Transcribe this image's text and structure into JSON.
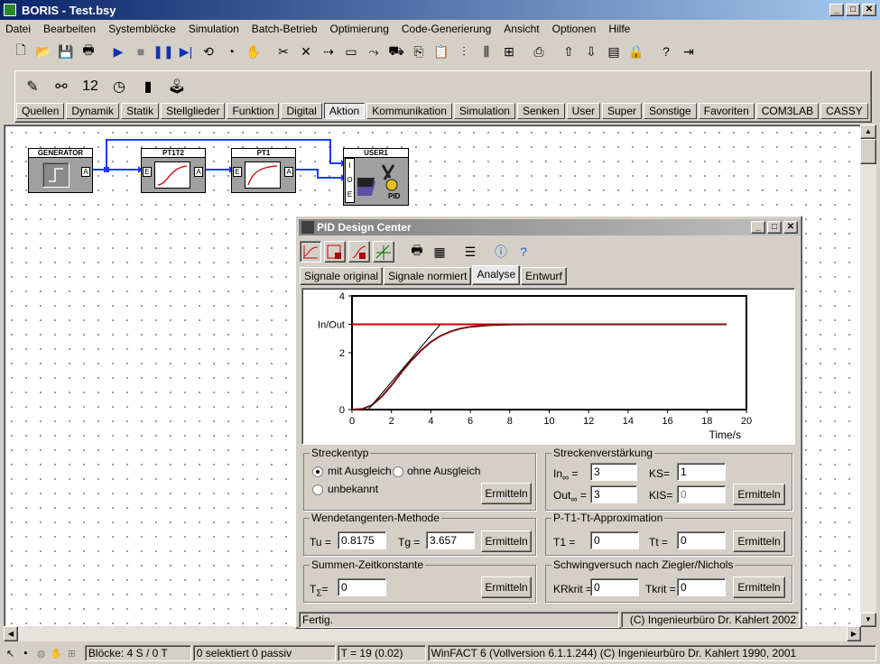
{
  "window": {
    "title": "BORIS - Test.bsy",
    "minimize": "_",
    "maximize": "□",
    "close": "✕"
  },
  "menu": [
    "Datei",
    "Bearbeiten",
    "Systemblöcke",
    "Simulation",
    "Batch-Betrieb",
    "Optimierung",
    "Code-Generierung",
    "Ansicht",
    "Optionen",
    "Hilfe"
  ],
  "toolbar_icons": [
    "new-file-icon",
    "open-folder-icon",
    "save-icon",
    "print-icon",
    "play-icon",
    "stop-icon",
    "pause-icon",
    "step-icon",
    "reset-icon",
    "clock-icon",
    "hand-icon",
    "cut-icon",
    "delete-icon",
    "connect-icon",
    "block-icon",
    "wire-icon",
    "truck-icon",
    "copy-icon",
    "paste-icon",
    "align-icon",
    "distribute-icon",
    "grid-icon",
    "library-icon",
    "move-up-icon",
    "move-down-icon",
    "property-icon",
    "lock-icon",
    "help-icon",
    "exit-icon"
  ],
  "palette_icons": [
    "pencil-block-icon",
    "connector-icon",
    "number-block-icon",
    "meter-icon",
    "bargraph-icon",
    "joystick-icon"
  ],
  "palette_tabs": [
    "Quellen",
    "Dynamik",
    "Statik",
    "Stellglieder",
    "Funktion",
    "Digital",
    "Aktion",
    "Kommunikation",
    "Simulation",
    "Senken",
    "User",
    "Super",
    "Sonstige",
    "Favoriten",
    "COM3LAB",
    "CASSY"
  ],
  "active_palette_tab": "Aktion",
  "blocks": {
    "generator": {
      "title": "GENERATOR",
      "out": "A"
    },
    "pt1t2": {
      "title": "PT1T2",
      "in": "E",
      "out": "A"
    },
    "pt1": {
      "title": "PT1",
      "in": "E",
      "out": "A"
    },
    "user1": {
      "title": "USER1",
      "ports": [
        "I",
        "O",
        "E"
      ],
      "tag": "PID"
    }
  },
  "status": {
    "blocks": "Blöcke: 4 S / 0 T",
    "selected": "0 selektiert  0 passiv",
    "time": "T = 19  (0.02)",
    "version": "WinFACT 6 (Vollversion 6.1.1.244)  (C) Ingenieurbüro Dr. Kahlert 1990, 2001"
  },
  "dialog": {
    "title": "PID Design Center",
    "tabs": [
      "Signale original",
      "Signale normiert",
      "Analyse",
      "Entwurf"
    ],
    "active_tab": "Analyse",
    "statusbar_left": "Fertig.",
    "statusbar_right": "(C) Ingenieurbüro Dr. Kahlert 2002",
    "streckentyp": {
      "title": "Streckentyp",
      "opt1": "mit Ausgleich",
      "opt2": "ohne Ausgleich",
      "opt3": "unbekannt",
      "selected": "mit Ausgleich",
      "btn": "Ermitteln"
    },
    "verstaerkung": {
      "title": "Streckenverstärkung",
      "in_label": "In",
      "inf": "∞",
      "in_eq": "=",
      "in_val": "3",
      "out_label": "Out",
      "out_val": "3",
      "ks_label": "KS=",
      "ks_val": "1",
      "kis_label": "KIS=",
      "kis_val": "0",
      "btn": "Ermitteln"
    },
    "wendetangente": {
      "title": "Wendetangenten-Methode",
      "tu_label": "Tu =",
      "tu_val": "0.8175",
      "tg_label": "Tg =",
      "tg_val": "3.657",
      "btn": "Ermitteln"
    },
    "approx": {
      "title": "P-T1-Tt-Approximation",
      "t1_label": "T1 =",
      "t1_val": "0",
      "tt_label": "Tt =",
      "tt_val": "0",
      "btn": "Ermitteln"
    },
    "summen": {
      "title": "Summen-Zeitkonstante",
      "label": "T",
      "sub": "Σ",
      "eq": "=",
      "val": "0",
      "btn": "Ermitteln"
    },
    "ziegler": {
      "title": "Schwingversuch nach Ziegler/Nichols",
      "kr_label": "KRkrit =",
      "kr_val": "0",
      "tk_label": "Tkrit =",
      "tk_val": "0",
      "btn": "Ermitteln"
    }
  },
  "chart_data": {
    "type": "line",
    "xlabel": "Time/s",
    "ylabel": "",
    "xlim": [
      0,
      20
    ],
    "ylim": [
      0,
      4
    ],
    "xticks": [
      "0",
      "2",
      "4",
      "6",
      "8",
      "10",
      "12",
      "14",
      "16",
      "18",
      "20"
    ],
    "yticks": [
      "0",
      "2",
      "4"
    ],
    "ymarker_label": "In/Out",
    "series": [
      {
        "role": "input",
        "color": "#cc0000",
        "x": [
          0,
          19
        ],
        "y": [
          3,
          3
        ]
      },
      {
        "role": "output",
        "color": "#7a1010",
        "x": [
          0,
          0.5,
          1,
          1.5,
          2,
          2.5,
          3,
          3.5,
          4,
          4.5,
          5,
          5.5,
          6,
          7,
          8,
          9,
          10,
          12,
          14,
          16,
          19
        ],
        "y": [
          0,
          0.02,
          0.15,
          0.45,
          0.85,
          1.3,
          1.72,
          2.08,
          2.38,
          2.6,
          2.75,
          2.85,
          2.91,
          2.97,
          2.99,
          3,
          3,
          3,
          3,
          3,
          3
        ]
      },
      {
        "role": "tangent",
        "color": "#000000",
        "x": [
          0.8175,
          4.4745
        ],
        "y": [
          0,
          3
        ]
      }
    ],
    "grid": false
  }
}
